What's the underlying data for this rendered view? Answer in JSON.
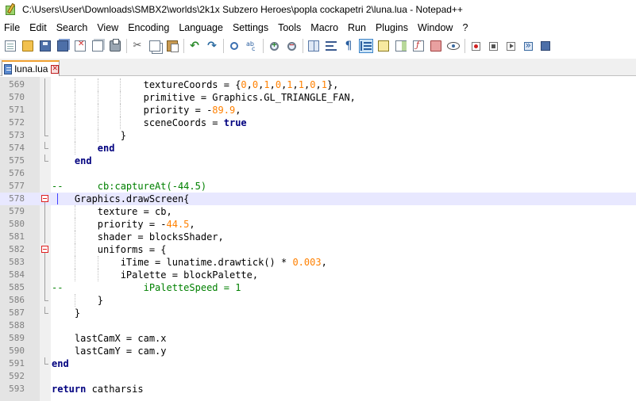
{
  "window": {
    "title": "C:\\Users\\User\\Downloads\\SMBX2\\worlds\\2k1x Subzero Heroes\\popla cockapetri 2\\luna.lua - Notepad++"
  },
  "menu": [
    "File",
    "Edit",
    "Search",
    "View",
    "Encoding",
    "Language",
    "Settings",
    "Tools",
    "Macro",
    "Run",
    "Plugins",
    "Window",
    "?"
  ],
  "toolbar": {
    "icons": [
      "new-file-icon",
      "open-file-icon",
      "save-icon",
      "save-all-icon",
      "close-icon",
      "close-all-icon",
      "print-icon",
      "cut-icon",
      "copy-icon",
      "paste-icon",
      "undo-icon",
      "redo-icon",
      "find-icon",
      "replace-icon",
      "zoom-in-icon",
      "zoom-out-icon",
      "sync-scroll-icon",
      "word-wrap-icon",
      "show-all-chars-icon",
      "indent-guide-icon",
      "user-defined-lang-icon",
      "document-map-icon",
      "function-list-icon",
      "folder-workspace-icon",
      "monitoring-icon",
      "record-macro-icon",
      "stop-record-icon",
      "playback-macro-icon",
      "run-macro-multiple-icon",
      "save-macro-icon"
    ],
    "active_index": 19
  },
  "tabs": [
    {
      "label": "luna.lua",
      "active": true
    }
  ],
  "editor": {
    "current_line": 578,
    "colors": {
      "comment": "#008000",
      "number": "#ff8000",
      "keyword": "#00007f",
      "line_number": "#808080",
      "current_line_bg": "#e8e8ff",
      "fold_box": "#e02020"
    },
    "lines": [
      {
        "n": "569",
        "indent": 16,
        "tokens": [
          [
            "t",
            "textureCoords = {"
          ],
          [
            "num",
            "0"
          ],
          [
            "t",
            ","
          ],
          [
            "num",
            "0"
          ],
          [
            "t",
            ","
          ],
          [
            "num",
            "1"
          ],
          [
            "t",
            ","
          ],
          [
            "num",
            "0"
          ],
          [
            "t",
            ","
          ],
          [
            "num",
            "1"
          ],
          [
            "t",
            ","
          ],
          [
            "num",
            "1"
          ],
          [
            "t",
            ","
          ],
          [
            "num",
            "0"
          ],
          [
            "t",
            ","
          ],
          [
            "num",
            "1"
          ],
          [
            "t",
            "},"
          ]
        ]
      },
      {
        "n": "570",
        "indent": 16,
        "tokens": [
          [
            "t",
            "primitive = Graphics.GL_TRIANGLE_FAN,"
          ]
        ]
      },
      {
        "n": "571",
        "indent": 16,
        "tokens": [
          [
            "t",
            "priority = -"
          ],
          [
            "num",
            "89.9"
          ],
          [
            "t",
            ","
          ]
        ]
      },
      {
        "n": "572",
        "indent": 16,
        "tokens": [
          [
            "t",
            "sceneCoords = "
          ],
          [
            "kw",
            "true"
          ]
        ]
      },
      {
        "n": "573",
        "indent": 12,
        "tokens": [
          [
            "t",
            "}"
          ]
        ]
      },
      {
        "n": "574",
        "indent": 8,
        "tokens": [
          [
            "kw",
            "end"
          ]
        ]
      },
      {
        "n": "575",
        "indent": 4,
        "tokens": [
          [
            "kw",
            "end"
          ]
        ]
      },
      {
        "n": "576",
        "indent": 0,
        "tokens": []
      },
      {
        "n": "577",
        "indent": 4,
        "tokens": [
          [
            "com",
            "--      cb:captureAt(-44.5)"
          ]
        ],
        "raw": true
      },
      {
        "n": "578",
        "indent": 4,
        "tokens": [
          [
            "t",
            "Graphics.drawScreen{"
          ]
        ]
      },
      {
        "n": "579",
        "indent": 8,
        "tokens": [
          [
            "t",
            "texture = cb,"
          ]
        ]
      },
      {
        "n": "580",
        "indent": 8,
        "tokens": [
          [
            "t",
            "priority = -"
          ],
          [
            "num",
            "44.5"
          ],
          [
            "t",
            ","
          ]
        ]
      },
      {
        "n": "581",
        "indent": 8,
        "tokens": [
          [
            "t",
            "shader = blocksShader,"
          ]
        ]
      },
      {
        "n": "582",
        "indent": 8,
        "tokens": [
          [
            "t",
            "uniforms = {"
          ]
        ]
      },
      {
        "n": "583",
        "indent": 12,
        "tokens": [
          [
            "t",
            "iTime = lunatime.drawtick() * "
          ],
          [
            "num",
            "0.003"
          ],
          [
            "t",
            ","
          ]
        ]
      },
      {
        "n": "584",
        "indent": 12,
        "tokens": [
          [
            "t",
            "iPalette = blockPalette,"
          ]
        ]
      },
      {
        "n": "585",
        "indent": 0,
        "tokens": [
          [
            "com",
            "--              iPaletteSpeed = 1"
          ]
        ],
        "raw": true
      },
      {
        "n": "586",
        "indent": 8,
        "tokens": [
          [
            "t",
            "}"
          ]
        ]
      },
      {
        "n": "587",
        "indent": 4,
        "tokens": [
          [
            "t",
            "}"
          ]
        ]
      },
      {
        "n": "588",
        "indent": 0,
        "tokens": []
      },
      {
        "n": "589",
        "indent": 4,
        "tokens": [
          [
            "t",
            "lastCamX = cam.x"
          ]
        ]
      },
      {
        "n": "590",
        "indent": 4,
        "tokens": [
          [
            "t",
            "lastCamY = cam.y"
          ]
        ]
      },
      {
        "n": "591",
        "indent": 0,
        "tokens": [
          [
            "kw",
            "end"
          ]
        ]
      },
      {
        "n": "592",
        "indent": 0,
        "tokens": []
      },
      {
        "n": "593",
        "indent": 0,
        "tokens": [
          [
            "kw",
            "return"
          ],
          [
            "t",
            " catharsis"
          ]
        ]
      }
    ]
  }
}
